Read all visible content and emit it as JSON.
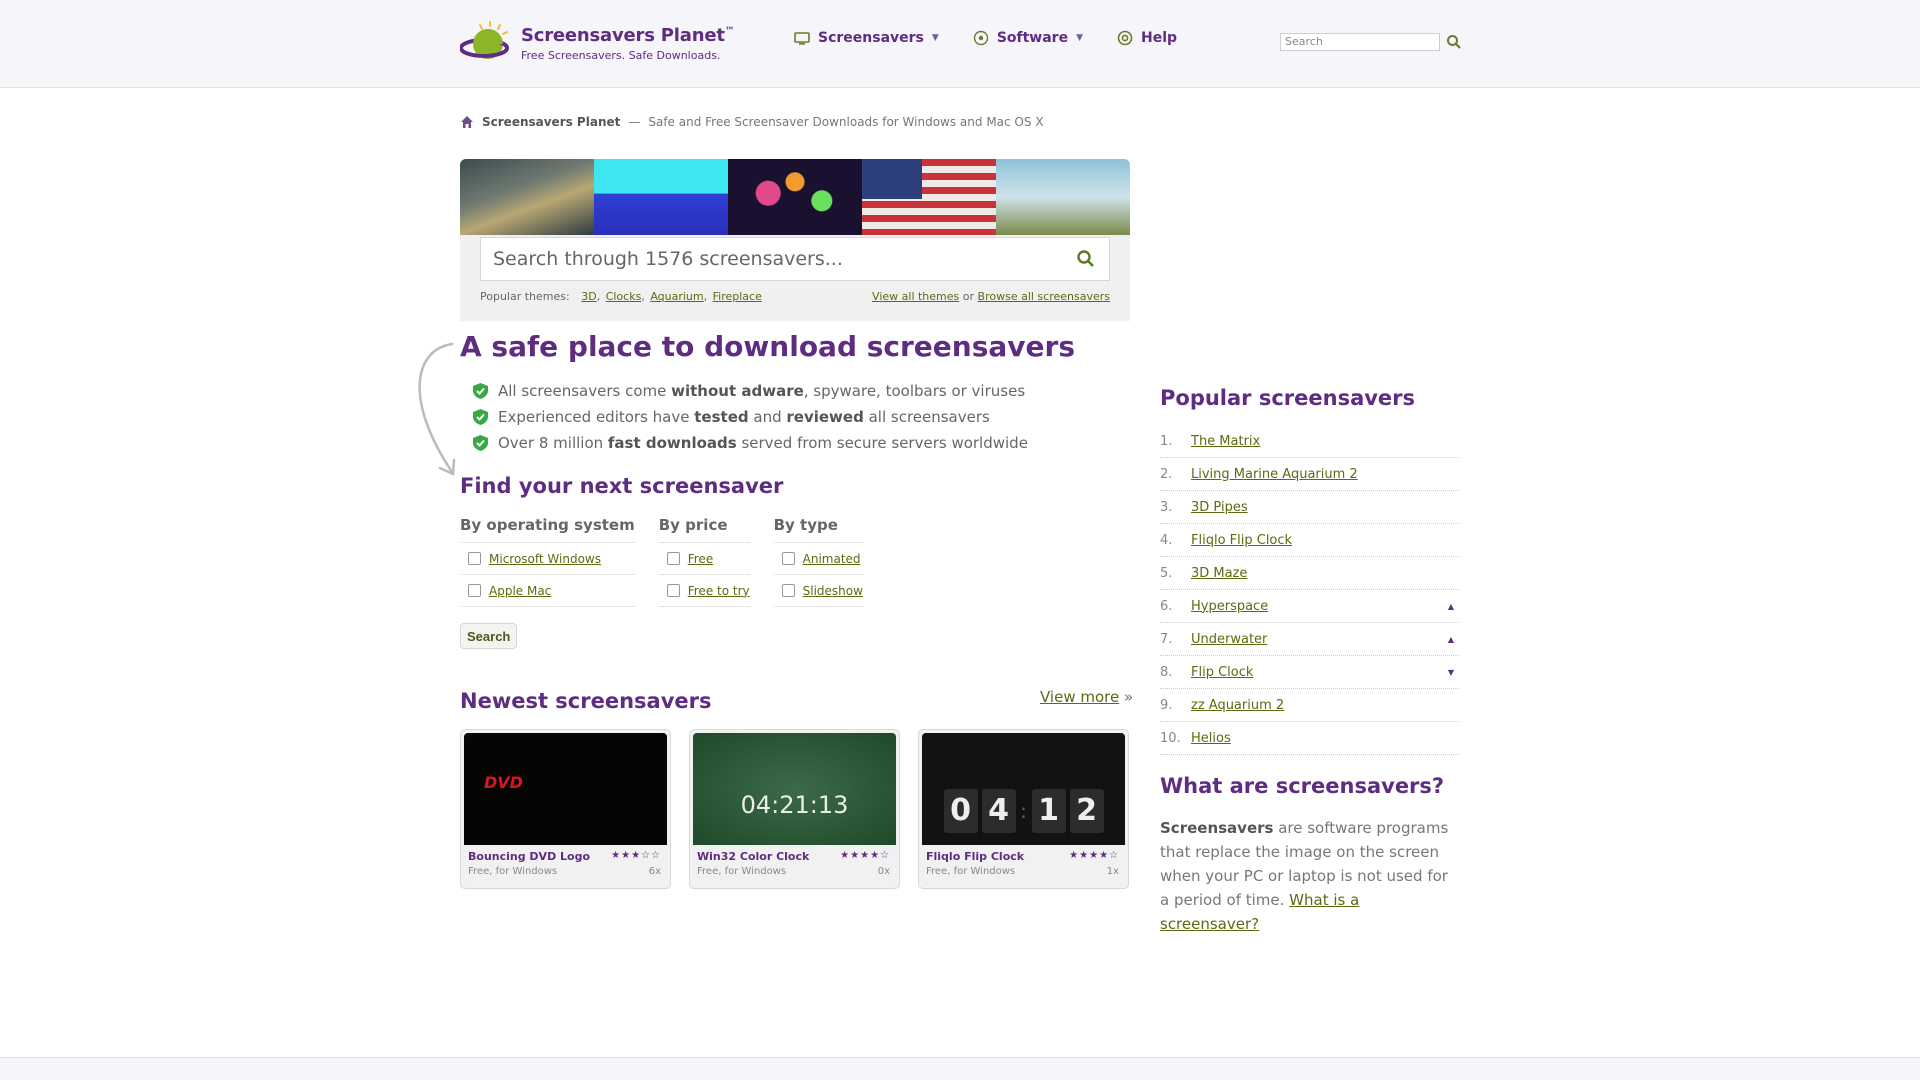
{
  "header": {
    "logo_name": "Screensavers Planet",
    "logo_tm": "™",
    "logo_tagline": "Free Screensavers. Safe Downloads.",
    "nav": [
      {
        "label": "Screensavers"
      },
      {
        "label": "Software"
      },
      {
        "label": "Help"
      }
    ],
    "search_placeholder": "Search"
  },
  "breadcrumb": {
    "site": "Screensavers Planet",
    "separator": "—",
    "description": "Safe and Free Screensaver Downloads for Windows and Mac OS X"
  },
  "hero": {
    "search_placeholder": "Search through 1576 screensavers...",
    "themes_label": "Popular themes:",
    "themes": [
      "3D",
      "Clocks",
      "Aquarium",
      "Fireplace"
    ],
    "view_all": "View all themes",
    "or": "or",
    "browse_all": "Browse all screensavers"
  },
  "intro": {
    "title": "A safe place to download screensavers",
    "bullets": [
      {
        "pre": "All screensavers come ",
        "bold": "without adware",
        "post": ", spyware, toolbars or viruses"
      },
      {
        "pre": "Experienced editors have ",
        "bold": "tested",
        "mid": " and ",
        "bold2": "reviewed",
        "post": " all screensavers"
      },
      {
        "pre": "Over 8 million ",
        "bold": "fast downloads",
        "post": " served from secure servers worldwide"
      }
    ]
  },
  "finder": {
    "title": "Find your next screensaver",
    "columns": [
      {
        "heading": "By operating system",
        "options": [
          "Microsoft Windows",
          "Apple Mac"
        ]
      },
      {
        "heading": "By price",
        "options": [
          "Free",
          "Free to try"
        ]
      },
      {
        "heading": "By type",
        "options": [
          "Animated",
          "Slideshow"
        ]
      }
    ],
    "search_button": "Search"
  },
  "newest": {
    "title": "Newest screensavers",
    "view_more": "View more",
    "view_more_arrow": "»",
    "cards": [
      {
        "title": "Bouncing DVD Logo",
        "sub": "Free, for Windows",
        "stars": "★★★☆☆",
        "count": "6x",
        "image_text": "DVD"
      },
      {
        "title": "Win32 Color Clock",
        "sub": "Free, for Windows",
        "stars": "★★★★☆",
        "count": "0x",
        "image_text": "04:21:13"
      },
      {
        "title": "Fliqlo Flip Clock",
        "sub": "Free, for Windows",
        "stars": "★★★★☆",
        "count": "1x",
        "digits": [
          "0",
          "4",
          "1",
          "2"
        ],
        "colon": ":"
      }
    ]
  },
  "popular": {
    "title": "Popular screensavers",
    "items": [
      {
        "num": "1.",
        "name": "The Matrix",
        "trend": ""
      },
      {
        "num": "2.",
        "name": "Living Marine Aquarium 2",
        "trend": ""
      },
      {
        "num": "3.",
        "name": "3D Pipes",
        "trend": ""
      },
      {
        "num": "4.",
        "name": "Fliqlo Flip Clock",
        "trend": ""
      },
      {
        "num": "5.",
        "name": "3D Maze",
        "trend": ""
      },
      {
        "num": "6.",
        "name": "Hyperspace",
        "trend": "▲"
      },
      {
        "num": "7.",
        "name": "Underwater",
        "trend": "▲"
      },
      {
        "num": "8.",
        "name": "Flip Clock",
        "trend": "▼"
      },
      {
        "num": "9.",
        "name": "zz Aquarium 2",
        "trend": ""
      },
      {
        "num": "10.",
        "name": "Helios",
        "trend": ""
      }
    ]
  },
  "what": {
    "title": "What are screensavers?",
    "bold": "Screensavers",
    "text": " are software programs that replace the image on the screen when your PC or laptop is not used for a period of time. ",
    "link": "What is a screensaver?"
  },
  "colors": {
    "brand_purple": "#5e2d82",
    "link_green": "#5b6b0f",
    "check_green": "#3aa847"
  },
  "icons": [
    "planet-logo-icon",
    "monitor-icon",
    "software-icon",
    "help-icon",
    "search-icon",
    "home-icon",
    "shield-check-icon",
    "caret-down-icon",
    "arrow-deco-icon"
  ]
}
